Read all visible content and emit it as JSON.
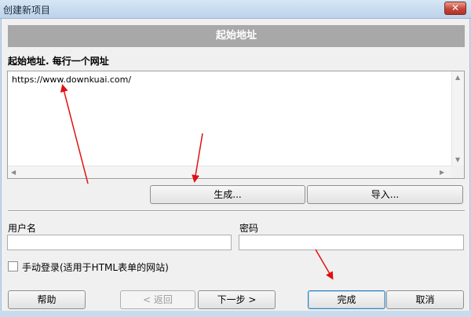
{
  "window": {
    "title": "创建新项目",
    "close_glyph": "✕"
  },
  "banner": {
    "title": "起始地址"
  },
  "urls": {
    "label": "起始地址. 每行一个网址",
    "value": "https://www.downkuai.com/"
  },
  "buttons": {
    "generate": "生成...",
    "import": "导入...",
    "help": "帮助",
    "back": "< 返回",
    "next": "下一步 >",
    "finish": "完成",
    "cancel": "取消"
  },
  "credentials": {
    "username_label": "用户名",
    "username_value": "",
    "password_label": "密码",
    "password_value": ""
  },
  "manual_login": {
    "label": "手动登录(适用于HTML表单的网站)",
    "checked": false
  },
  "colors": {
    "annotation_arrow": "#e01010",
    "banner": "#a8a8a8"
  }
}
